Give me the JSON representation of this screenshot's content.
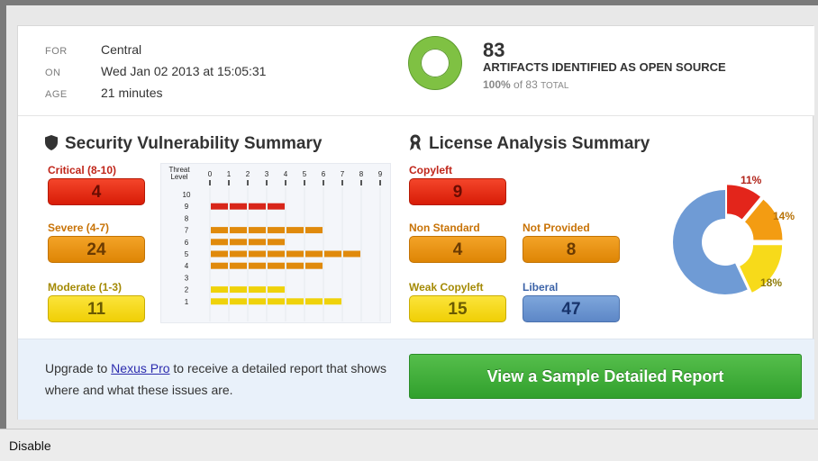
{
  "meta": {
    "for_key": "FOR",
    "for_val": "Central",
    "on_key": "ON",
    "on_val": "Wed Jan 02 2013 at 15:05:31",
    "age_key": "AGE",
    "age_val": "21 minutes"
  },
  "summary": {
    "count": "83",
    "label": "ARTIFACTS IDENTIFIED AS OPEN SOURCE",
    "percent": "100%",
    "of_text": "of 83",
    "total_text": "TOTAL",
    "ring_fill": 1.0,
    "ring_color": "#7fc143"
  },
  "security": {
    "title": "Security Vulnerability Summary",
    "icon": "shield-icon",
    "critical_label": "Critical (8-10)",
    "critical_value": "4",
    "severe_label": "Severe (4-7)",
    "severe_value": "24",
    "moderate_label": "Moderate (1-3)",
    "moderate_value": "11"
  },
  "license": {
    "title": "License Analysis Summary",
    "icon": "ribbon-icon",
    "copyleft_label": "Copyleft",
    "copyleft_value": "9",
    "nonstandard_label": "Non Standard",
    "nonstandard_value": "4",
    "notprovided_label": "Not Provided",
    "notprovided_value": "8",
    "weak_label": "Weak Copyleft",
    "weak_value": "15",
    "liberal_label": "Liberal",
    "liberal_value": "47"
  },
  "chart_data": [
    {
      "type": "bar",
      "ylabel": "Threat Level",
      "categories": [
        "10",
        "9",
        "8",
        "7",
        "6",
        "5",
        "4",
        "3",
        "2",
        "1"
      ],
      "values": [
        0,
        4,
        0,
        6,
        4,
        8,
        6,
        0,
        4,
        7
      ],
      "xticks": [
        "0",
        "1",
        "2",
        "3",
        "4",
        "5",
        "6",
        "7",
        "8",
        "9"
      ],
      "xlim": [
        0,
        9
      ],
      "colors": {
        "critical": "#d8261a",
        "severe": "#e08a0c",
        "moderate": "#efd20a"
      }
    },
    {
      "type": "pie",
      "slices": [
        {
          "label": "11%",
          "value": 11,
          "color": "#e3251b"
        },
        {
          "label": "14%",
          "value": 14,
          "color": "#f39c12"
        },
        {
          "label": "18%",
          "value": 18,
          "color": "#f7da1a"
        },
        {
          "label": "",
          "value": 57,
          "color": "#6f9bd5"
        }
      ]
    }
  ],
  "footer": {
    "text_before": "Upgrade to",
    "link": "Nexus Pro",
    "text_after": "to receive a detailed report that shows where and what these issues are.",
    "cta": "View a Sample Detailed Report"
  },
  "statusbar": {
    "disable": "Disable"
  }
}
